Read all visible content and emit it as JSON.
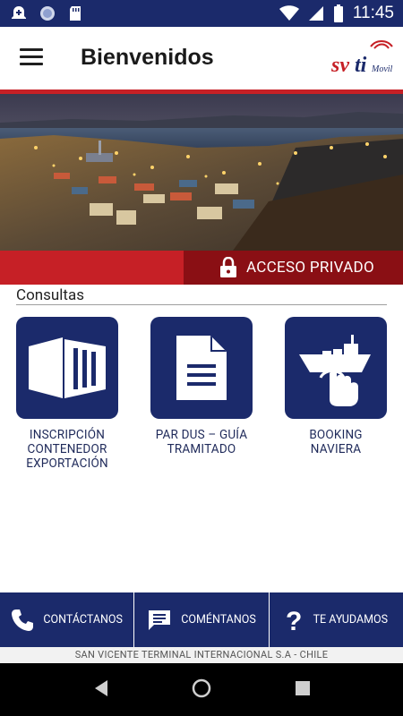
{
  "status_bar": {
    "time": "11:45",
    "icons": [
      "alert-icon",
      "sync-icon",
      "sd-card-icon",
      "wifi-icon",
      "signal-icon",
      "battery-icon"
    ]
  },
  "app_bar": {
    "title": "Bienvenidos",
    "menu_icon": "hamburger-menu-icon",
    "logo_text": "svti",
    "logo_suffix": "Movil"
  },
  "access": {
    "label": "ACCESO PRIVADO",
    "icon": "lock-icon"
  },
  "section": {
    "title": "Consultas"
  },
  "tiles": [
    {
      "label_lines": [
        "INSCRIPCIÓN",
        "CONTENEDOR",
        "EXPORTACIÓN"
      ],
      "icon": "container-icon"
    },
    {
      "label_lines": [
        "PAR DUS – GUÍA",
        "TRAMITADO"
      ],
      "icon": "document-icon"
    },
    {
      "label_lines": [
        "BOOKING",
        "NAVIERA"
      ],
      "icon": "ship-touch-icon"
    }
  ],
  "bottom_nav": [
    {
      "label": "CONTÁCTANOS",
      "icon": "phone-icon"
    },
    {
      "label": "COMÉNTANOS",
      "icon": "comment-icon"
    },
    {
      "label": "TE AYUDAMOS",
      "icon": "help-icon"
    }
  ],
  "footer": {
    "text": "SAN VICENTE TERMINAL INTERNACIONAL S.A - CHILE"
  },
  "colors": {
    "navy": "#1b2a6b",
    "red": "#c62026",
    "dark_red": "#8a0f14"
  }
}
